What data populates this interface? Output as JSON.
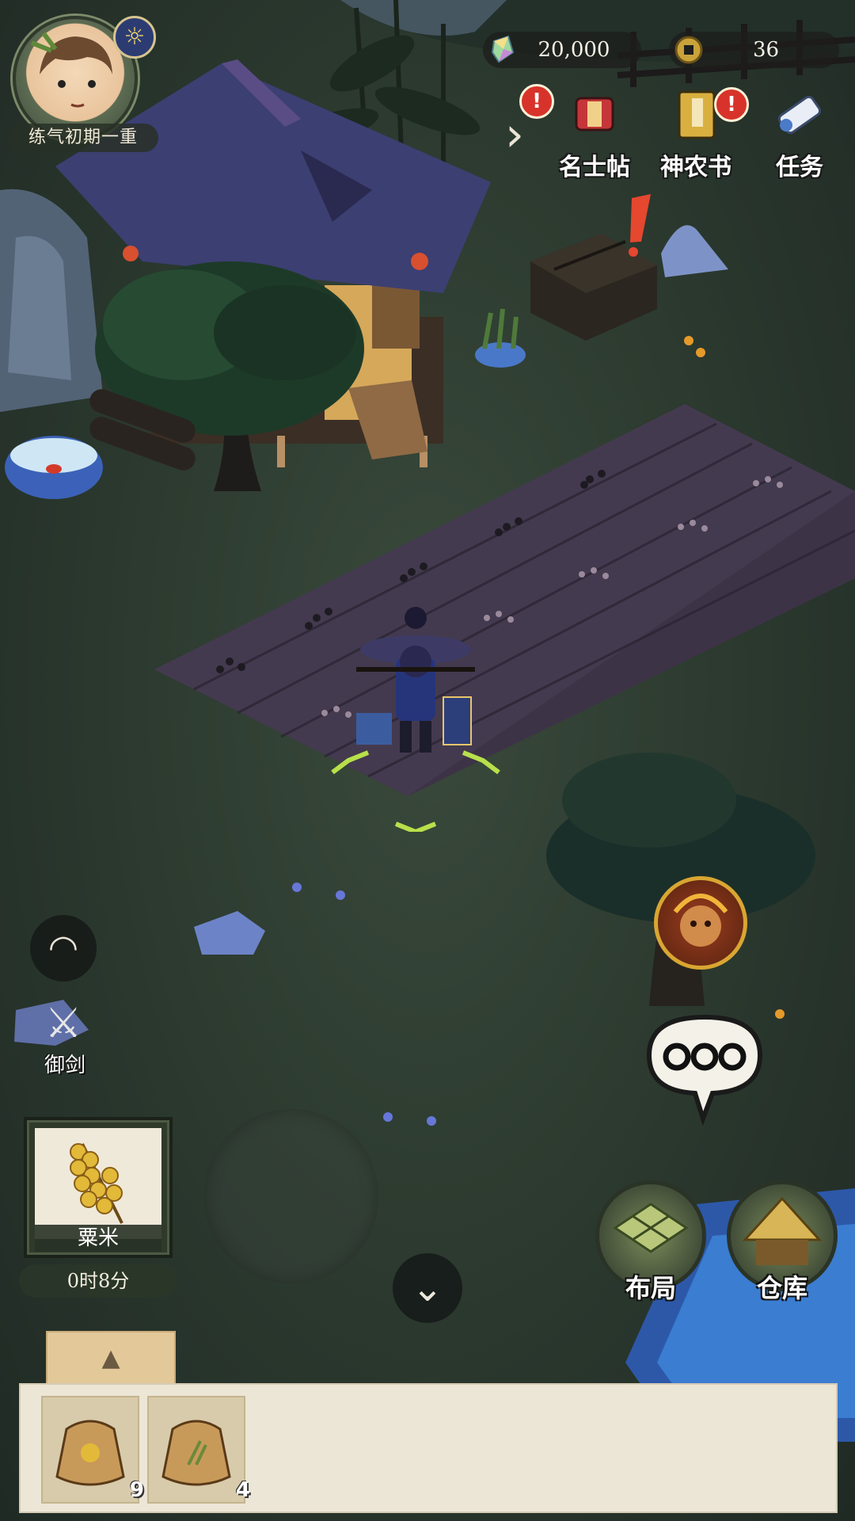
{
  "player": {
    "rank": "练气初期一重",
    "weather_icon": "sun-icon"
  },
  "currency": {
    "jade": "20,000",
    "coins": "36"
  },
  "menu": {
    "collapse_icon": "chevron-right-icon",
    "celebrity": "名士帖",
    "shennong": "神农书",
    "tasks": "任务",
    "alert": "!"
  },
  "left_controls": {
    "eye_icon": "eye-icon",
    "sword_label": "御剑"
  },
  "crop": {
    "name": "粟米",
    "timer": "0时8分"
  },
  "right_controls": {
    "chat_icon": "speech-bubble-icon",
    "layout_label": "布局",
    "storage_label": "仓库"
  },
  "inventory": {
    "tab_icon": "seed-pile-icon",
    "slots": [
      {
        "item": "millet-seed-bag",
        "count": "9"
      },
      {
        "item": "grass-seed-bag",
        "count": "4"
      }
    ]
  },
  "colors": {
    "grass": "#2d3b30",
    "field": "#3d3346",
    "roof": "#3a3a6a",
    "alert": "#d7332a",
    "selection": "#b8e04a"
  }
}
